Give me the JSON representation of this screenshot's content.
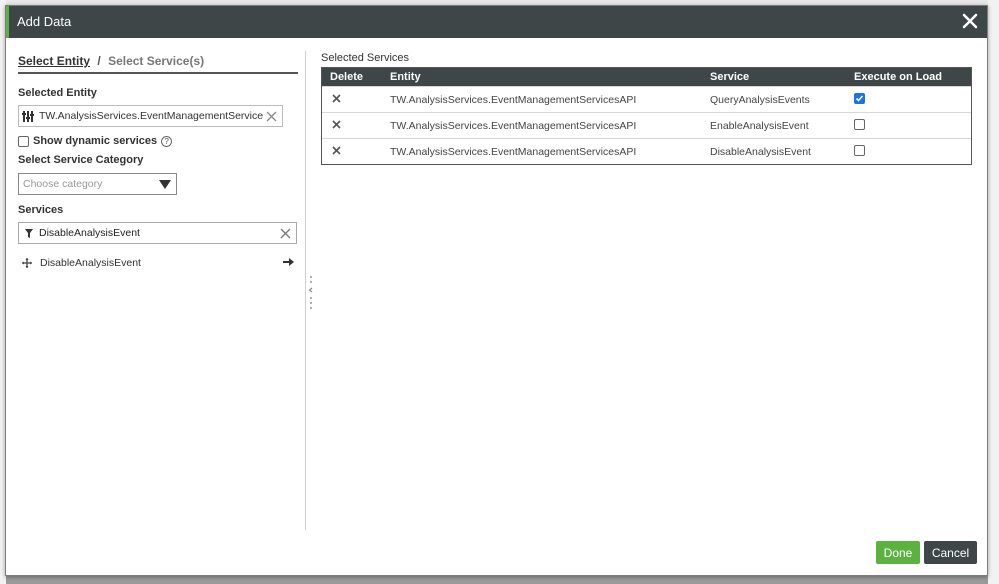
{
  "dialog": {
    "title": "Add Data",
    "close_icon": "close-icon"
  },
  "steps": {
    "step1": "Select Entity",
    "separator": "/",
    "step2": "Select Service(s)"
  },
  "left": {
    "selected_entity_label": "Selected Entity",
    "selected_entity_value": "TW.AnalysisServices.EventManagementServicesAPI",
    "show_dynamic_label": "Show dynamic services",
    "show_dynamic_checked": false,
    "category_label": "Select Service Category",
    "category_placeholder": "Choose category",
    "services_label": "Services",
    "services_filter_value": "DisableAnalysisEvent",
    "service_items": [
      {
        "name": "DisableAnalysisEvent"
      }
    ]
  },
  "right": {
    "selected_services_label": "Selected Services",
    "columns": [
      "Delete",
      "Entity",
      "Service",
      "Execute on Load"
    ],
    "rows": [
      {
        "entity": "TW.AnalysisServices.EventManagementServicesAPI",
        "service": "QueryAnalysisEvents",
        "execute_on_load": true
      },
      {
        "entity": "TW.AnalysisServices.EventManagementServicesAPI",
        "service": "EnableAnalysisEvent",
        "execute_on_load": false
      },
      {
        "entity": "TW.AnalysisServices.EventManagementServicesAPI",
        "service": "DisableAnalysisEvent",
        "execute_on_load": false
      }
    ]
  },
  "footer": {
    "done_label": "Done",
    "cancel_label": "Cancel"
  },
  "colors": {
    "header_bg": "#3e4647",
    "accent_green": "#5bb240",
    "checkbox_blue": "#1a73e8"
  }
}
